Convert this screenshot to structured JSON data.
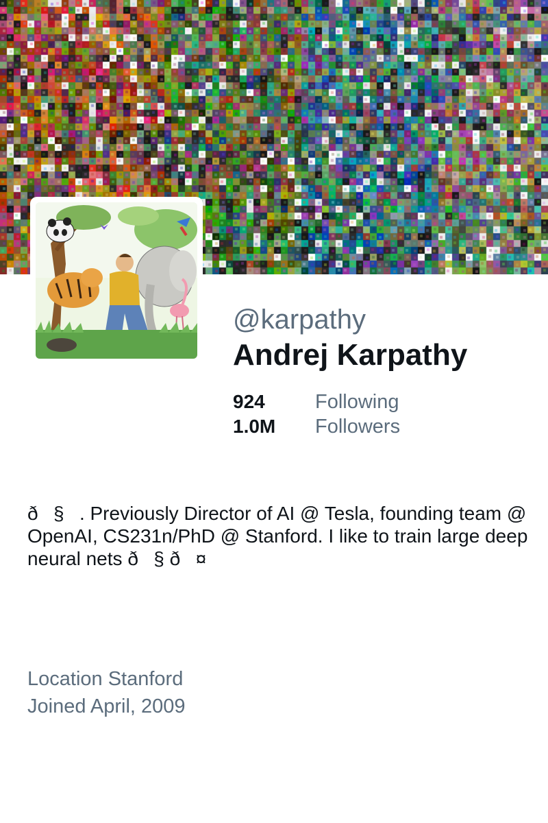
{
  "profile": {
    "handle": "@karpathy",
    "name": "Andrej Karpathy",
    "stats": [
      {
        "value": "924",
        "label": "Following"
      },
      {
        "value": "1.0M",
        "label": "Followers"
      }
    ],
    "bio": "ð§‍. Previously Director of AI @ Tesla, founding team @ OpenAI, CS231n/PhD @ Stanford. I like to train large deep neural nets ð§ ð¤",
    "location": "Location Stanford",
    "joined": "Joined April, 2009"
  },
  "colors": {
    "primary_text": "#0f1419",
    "secondary_text": "#5b6c7c",
    "background": "#ffffff"
  },
  "images": {
    "banner": "image-mosaic-banner",
    "avatar": "illustrated-jungle-portrait"
  }
}
